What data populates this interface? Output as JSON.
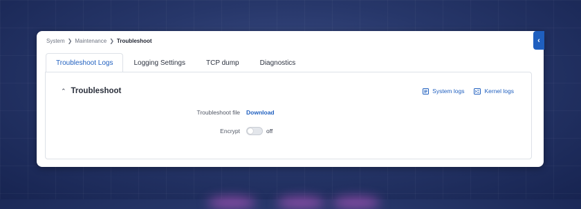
{
  "breadcrumb": [
    "System",
    "Maintenance",
    "Troubleshoot"
  ],
  "tabs": [
    "Troubleshoot Logs",
    "Logging Settings",
    "TCP dump",
    "Diagnostics"
  ],
  "active_tab": "Troubleshoot Logs",
  "section": {
    "title": "Troubleshoot"
  },
  "links": {
    "system_logs": "System logs",
    "kernel_logs": "Kernel logs"
  },
  "fields": {
    "file_label": "Troubleshoot file",
    "file_action": "Download",
    "encrypt_label": "Encrypt",
    "encrypt_state": "off",
    "encrypt_on": false
  },
  "colors": {
    "accent": "#1f5fbf",
    "background": "#27376a"
  },
  "icons": {
    "section_toggle": "chevron-up-icon",
    "collapse": "chevron-left-icon",
    "system_logs": "list-icon",
    "kernel_logs": "terminal-icon"
  }
}
